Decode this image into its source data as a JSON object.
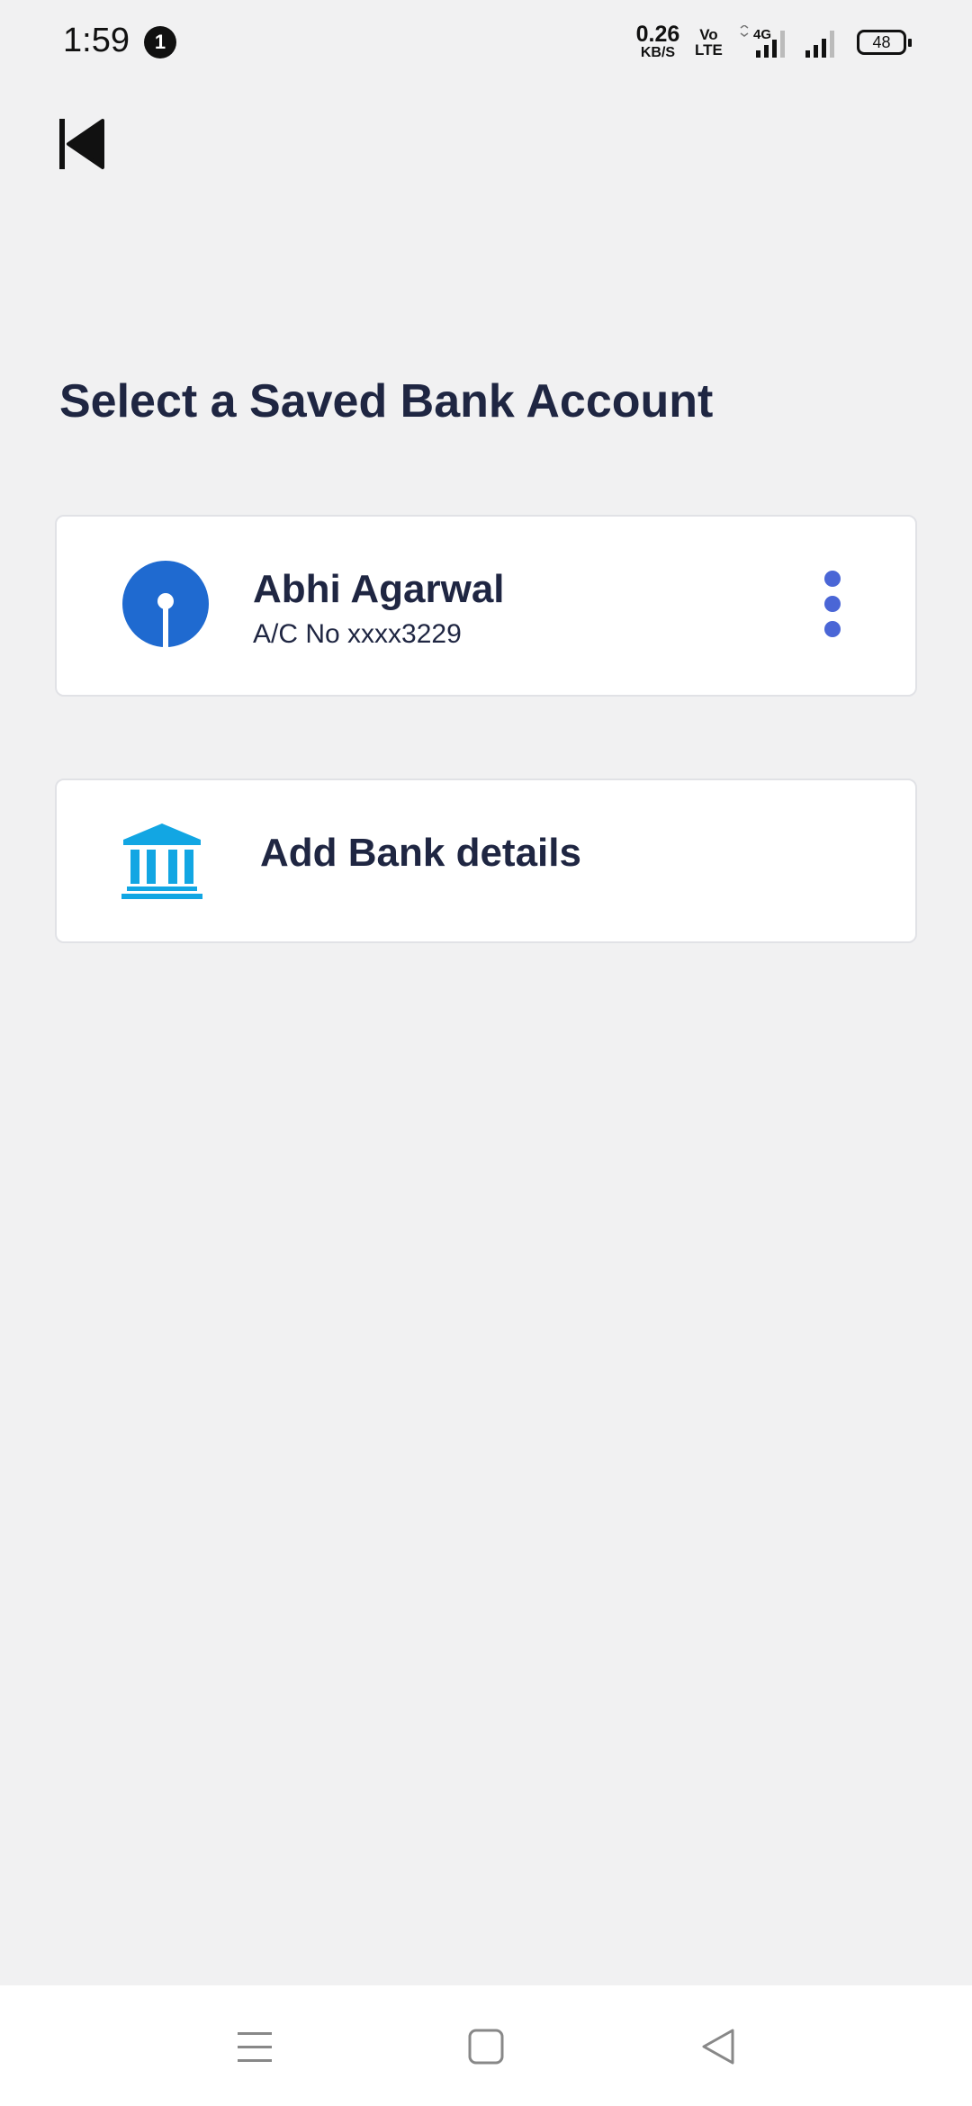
{
  "status_bar": {
    "time": "1:59",
    "notification_count": "1",
    "net_speed_value": "0.26",
    "net_speed_unit": "KB/S",
    "volte_line1": "Vo",
    "volte_line2": "LTE",
    "network_type": "4G",
    "battery": "48"
  },
  "page": {
    "title": "Select a Saved Bank Account"
  },
  "saved_account": {
    "name": "Abhi Agarwal",
    "account_number": "A/C No xxxx3229",
    "logo_icon": "sbi-logo-icon",
    "menu_icon": "more-vertical-icon"
  },
  "add_bank": {
    "label": "Add Bank details",
    "icon": "bank-building-icon"
  },
  "navigation": {
    "buttons": [
      "menu",
      "home",
      "back"
    ]
  },
  "colors": {
    "background": "#f1f1f2",
    "text_primary": "#1f2642",
    "accent_blue": "#4a66d6",
    "bank_icon": "#12a6e3",
    "sbi_blue": "#1f6ad0"
  }
}
